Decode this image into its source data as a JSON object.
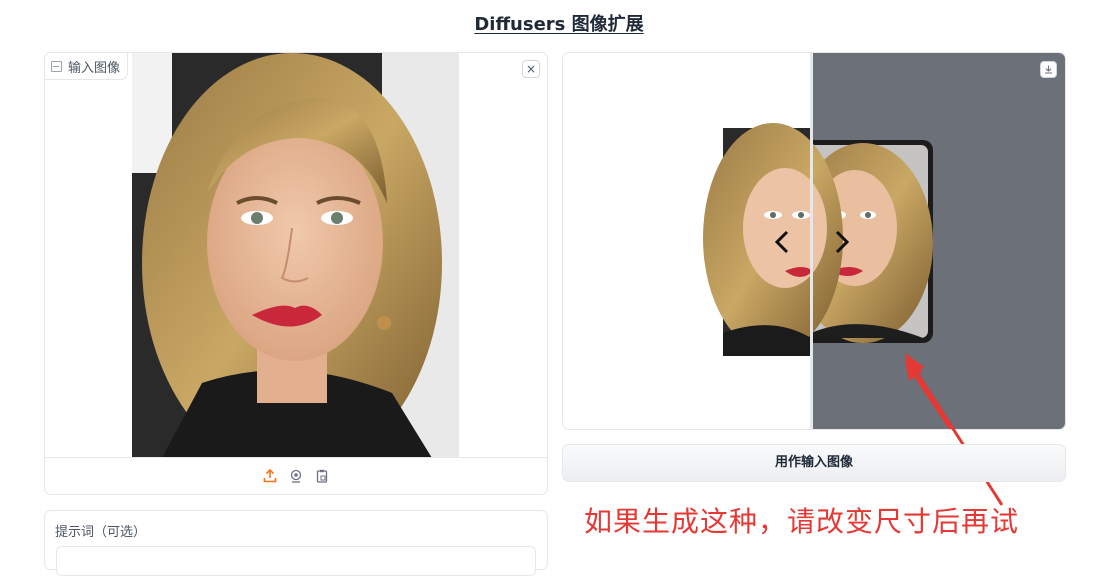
{
  "app": {
    "title": "Diffusers 图像扩展"
  },
  "input_image": {
    "label": "输入图像",
    "close_label": "×",
    "toolbar": [
      "upload-icon",
      "webcam-icon",
      "clipboard-icon"
    ]
  },
  "output_image": {
    "download_icon": "download-icon",
    "nav_prev": "‹",
    "nav_next": "›"
  },
  "use_as_input_button": {
    "label": "用作输入图像"
  },
  "annotation": {
    "text": "如果生成这种，请改变尺寸后再试",
    "color": "#e53935"
  },
  "prompt": {
    "label": "提示词（可选）",
    "value": "",
    "placeholder": ""
  },
  "colors": {
    "accent": "#f97316",
    "annotation": "#e53935"
  }
}
